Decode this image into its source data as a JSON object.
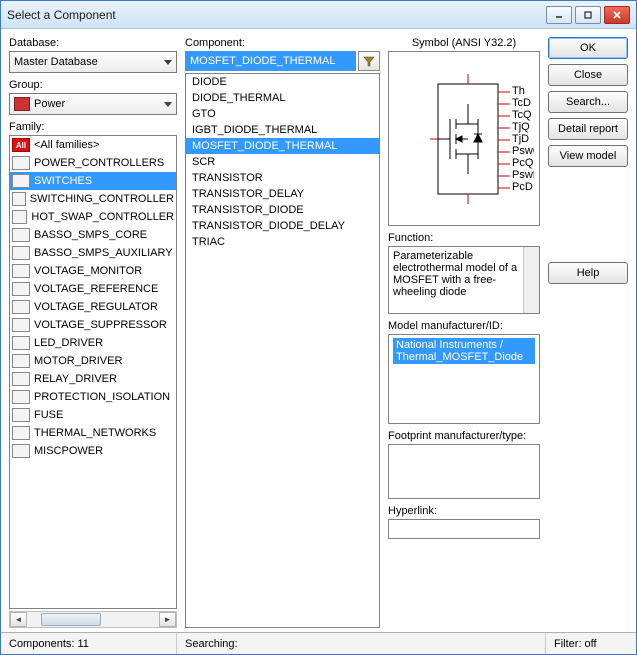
{
  "window": {
    "title": "Select a Component"
  },
  "left": {
    "database_label": "Database:",
    "database_value": "Master Database",
    "group_label": "Group:",
    "group_value": "Power",
    "family_label": "Family:",
    "families": [
      {
        "name": "<All families>",
        "icon": "All"
      },
      {
        "name": "POWER_CONTROLLERS"
      },
      {
        "name": "SWITCHES",
        "selected": true
      },
      {
        "name": "SWITCHING_CONTROLLER"
      },
      {
        "name": "HOT_SWAP_CONTROLLER"
      },
      {
        "name": "BASSO_SMPS_CORE"
      },
      {
        "name": "BASSO_SMPS_AUXILIARY"
      },
      {
        "name": "VOLTAGE_MONITOR"
      },
      {
        "name": "VOLTAGE_REFERENCE"
      },
      {
        "name": "VOLTAGE_REGULATOR"
      },
      {
        "name": "VOLTAGE_SUPPRESSOR"
      },
      {
        "name": "LED_DRIVER"
      },
      {
        "name": "MOTOR_DRIVER"
      },
      {
        "name": "RELAY_DRIVER"
      },
      {
        "name": "PROTECTION_ISOLATION"
      },
      {
        "name": "FUSE"
      },
      {
        "name": "THERMAL_NETWORKS"
      },
      {
        "name": "MISCPOWER"
      }
    ]
  },
  "mid": {
    "component_label": "Component:",
    "search_value": "MOSFET_DIODE_THERMAL",
    "components": [
      "DIODE",
      "DIODE_THERMAL",
      "GTO",
      "IGBT_DIODE_THERMAL",
      "MOSFET_DIODE_THERMAL",
      "SCR",
      "TRANSISTOR",
      "TRANSISTOR_DELAY",
      "TRANSISTOR_DIODE",
      "TRANSISTOR_DIODE_DELAY",
      "TRIAC"
    ],
    "selected_component": "MOSFET_DIODE_THERMAL"
  },
  "right": {
    "symbol_label": "Symbol (ANSI Y32.2)",
    "function_label": "Function:",
    "function_text": "Parameterizable electrothermal model of a MOSFET with a free-wheeling diode",
    "model_label": "Model manufacturer/ID:",
    "model_value": "National Instruments / Thermal_MOSFET_Diode",
    "footprint_label": "Footprint manufacturer/type:",
    "hyperlink_label": "Hyperlink:",
    "pin_labels": [
      "Th",
      "TcD",
      "TcQ",
      "TjQ",
      "TjD",
      "PswQ",
      "PcQ",
      "PswD",
      "PcD"
    ]
  },
  "buttons": {
    "ok": "OK",
    "close": "Close",
    "search": "Search...",
    "detail": "Detail report",
    "view": "View model",
    "help": "Help"
  },
  "status": {
    "components": "Components: 11",
    "searching": "Searching:",
    "filter": "Filter: off"
  }
}
